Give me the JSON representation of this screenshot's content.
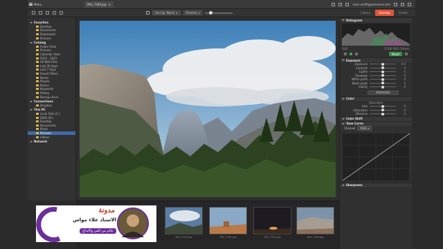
{
  "topbar": {
    "menu_label": "Menu",
    "file_name": "IMG_7280.jpg",
    "user": "marc.smith@someone.com"
  },
  "toolbar": {
    "sort_label": "Sort by: Name",
    "preview_label": "Preview",
    "tabs": [
      "Library",
      "Develop",
      "Create"
    ],
    "active_tab": "Develop"
  },
  "sidebar": {
    "items": [
      {
        "label": "Favorites",
        "type": "section"
      },
      {
        "label": "Desktop",
        "type": "folder"
      },
      {
        "label": "Documents",
        "type": "folder"
      },
      {
        "label": "Downloads",
        "type": "folder"
      },
      {
        "label": "Pictures",
        "type": "folder"
      },
      {
        "label": "Catalog",
        "type": "section"
      },
      {
        "label": "Folder View",
        "type": "folder"
      },
      {
        "label": "Pictures",
        "type": "folder"
      },
      {
        "label": "Calendar View",
        "type": "folder"
      },
      {
        "label": "2015 - 2021",
        "type": "folder"
      },
      {
        "label": "All Web Files",
        "type": "folder"
      },
      {
        "label": "Last 30 days",
        "type": "folder"
      },
      {
        "label": "Last 7 days",
        "type": "folder"
      },
      {
        "label": "Saved Filters",
        "type": "folder"
      },
      {
        "label": "Books",
        "type": "folder"
      },
      {
        "label": "People",
        "type": "folder"
      },
      {
        "label": "Places",
        "type": "folder"
      },
      {
        "label": "Keywords",
        "type": "folder"
      },
      {
        "label": "Rating",
        "type": "folder"
      },
      {
        "label": "Backup drive",
        "type": "folder"
      },
      {
        "label": "Connections",
        "type": "section"
      },
      {
        "label": "Dropbox",
        "type": "folder"
      },
      {
        "label": "This PC",
        "type": "section"
      },
      {
        "label": "Local Disk (C:)",
        "type": "folder"
      },
      {
        "label": "DATA (D:)",
        "type": "folder"
      },
      {
        "label": "Desktop",
        "type": "folder"
      },
      {
        "label": "Documents",
        "type": "folder"
      },
      {
        "label": "Music",
        "type": "folder"
      },
      {
        "label": "Pictures",
        "type": "folder",
        "selected": true
      },
      {
        "label": "Videos",
        "type": "folder"
      },
      {
        "label": "Network",
        "type": "section"
      }
    ]
  },
  "filmstrip": {
    "thumbs": [
      {
        "label": "IMG_7280.jpg"
      },
      {
        "label": "IMG_7281.jpg"
      },
      {
        "label": "IMG_7282.jpg"
      },
      {
        "label": "IMG_7283.jpg"
      }
    ]
  },
  "panel": {
    "histogram_title": "Histogram",
    "hist_left": "ISO",
    "hist_right": "1/100 f/8.0 24mm",
    "reset_label": "Reset",
    "exposure_title": "Exposure",
    "exposure_sliders": [
      {
        "label": "Exposure",
        "value": "0.0",
        "pos": 0.5
      },
      {
        "label": "Contrast",
        "value": "0",
        "pos": 0.5
      },
      {
        "label": "Lights",
        "value": "0",
        "pos": 0.5
      },
      {
        "label": "Shadows",
        "value": "0",
        "pos": 0.5
      },
      {
        "label": "White point",
        "value": "0",
        "pos": 0.5
      },
      {
        "label": "Black point",
        "value": "0",
        "pos": 0.5
      },
      {
        "label": "Clarity",
        "value": "0",
        "pos": 0.5
      }
    ],
    "auto_label": "Automatic",
    "color_title": "Color",
    "color_sub": "Saturation",
    "color_sliders": [
      {
        "label": "Hue",
        "value": "0",
        "pos": 0.5
      },
      {
        "label": "Saturation",
        "value": "0",
        "pos": 0.5
      },
      {
        "label": "Vibrance",
        "value": "0",
        "pos": 0.5
      }
    ],
    "color_wb_title": "Color Shift",
    "tone_title": "Tone Curve",
    "channel_label": "Channel",
    "channel_value": "RGB",
    "sharpness_title": "Sharpness"
  },
  "logo": {
    "line1": "مدونة",
    "line2": "الاستاذ علاء مواس",
    "line3": "عالم من الفن والابداع"
  },
  "colors": {
    "accent": "#e0553a",
    "selection": "#3f6aa8",
    "green": "#3a8f4b"
  }
}
